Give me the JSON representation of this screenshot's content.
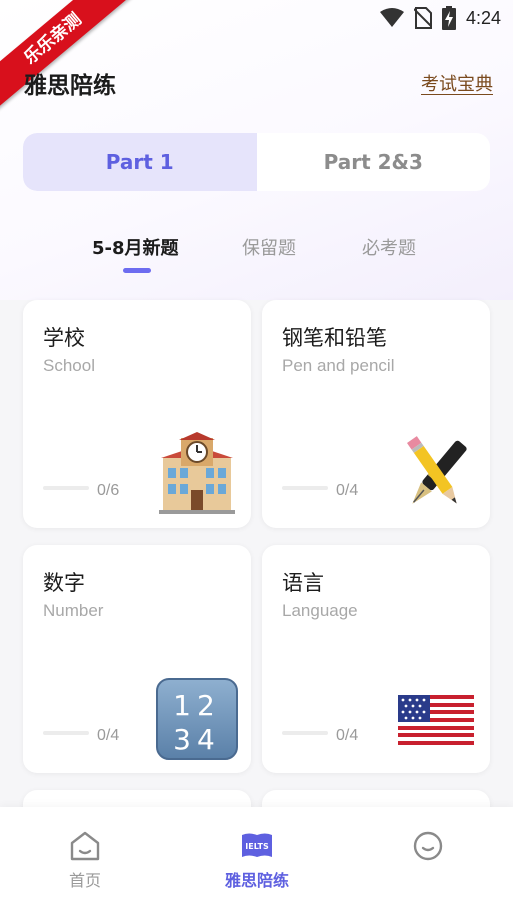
{
  "status_bar": {
    "time": "4:24"
  },
  "ribbon": {
    "text": "乐乐亲测"
  },
  "header": {
    "title": "雅思陪练",
    "link": "考试宝典"
  },
  "part_tabs": [
    {
      "label": "Part 1",
      "active": true
    },
    {
      "label": "Part 2&3",
      "active": false
    }
  ],
  "sub_tabs": [
    {
      "label": "5-8月新题",
      "active": true
    },
    {
      "label": "保留题",
      "active": false
    },
    {
      "label": "必考题",
      "active": false
    }
  ],
  "cards": [
    {
      "title": "学校",
      "subtitle": "School",
      "progress_text": "0/6",
      "progress": 0,
      "icon": "school-building-icon"
    },
    {
      "title": "钢笔和铅笔",
      "subtitle": "Pen and pencil",
      "progress_text": "0/4",
      "progress": 0,
      "icon": "pen-and-pencil-icon"
    },
    {
      "title": "数字",
      "subtitle": "Number",
      "progress_text": "0/4",
      "progress": 0,
      "icon": "numbers-1234-icon"
    },
    {
      "title": "语言",
      "subtitle": "Language",
      "progress_text": "0/4",
      "progress": 0,
      "icon": "us-flag-icon"
    }
  ],
  "bottom_nav": [
    {
      "label": "首页",
      "icon": "home-icon",
      "active": false
    },
    {
      "label": "雅思陪练",
      "icon": "ielts-book-icon",
      "active": true,
      "icon_text": "IELTS"
    },
    {
      "label": "",
      "icon": "profile-face-icon",
      "active": false
    }
  ],
  "colors": {
    "accent": "#5e60e0",
    "accent_light": "#e6e4fb",
    "ribbon": "#d8101c",
    "link": "#7a4a1e"
  }
}
